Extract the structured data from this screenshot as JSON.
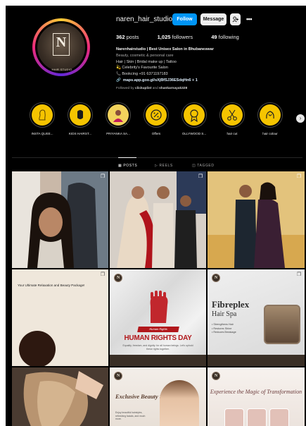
{
  "profile": {
    "username": "naren_hair_studio",
    "follow_label": "Follow",
    "message_label": "Message",
    "logo_text": "HAIR STUDIO",
    "stats": {
      "posts": "362",
      "posts_label": "posts",
      "followers": "1,025",
      "followers_label": "followers",
      "following": "49",
      "following_label": "following"
    },
    "bio": {
      "name": "Narenhairstudio | Best Unisex Salon in Bhubaneswar",
      "category": "Beauty, cosmetic & personal care",
      "line1": "Hair | Skin | Bridal make up | Tattoo",
      "line2": "💫 Celebrity's Favourite Salon",
      "line3": "📞 Bookcing +91 6371197183",
      "link": "maps.app.goo.gl/sXjBfSJ36ESdqHn6 + 1"
    },
    "followed_prefix": "Followed by",
    "followed_user1": "clickuplist",
    "followed_and": "and",
    "followed_user2": "shankarnayak328"
  },
  "highlights": [
    {
      "label": "INSTA QUEE...",
      "icon": "woman-profile-icon"
    },
    {
      "label": "KIDS HAIRST...",
      "icon": "kid-head-icon"
    },
    {
      "label": "PRIYANKA SA...",
      "icon": "portrait-photo-icon"
    },
    {
      "label": "Offers",
      "icon": "offer-badge-icon"
    },
    {
      "label": "OLLYWOOD S...",
      "icon": "award-medal-icon"
    },
    {
      "label": "hair cut",
      "icon": "scissors-icon"
    },
    {
      "label": "hair colour",
      "icon": "hair-dye-icon"
    }
  ],
  "tabs": {
    "posts": "POSTS",
    "reels": "REELS",
    "tagged": "TAGGED"
  },
  "posts": {
    "p4_caption": "Your Ultimate Relaxation and Beauty Package!",
    "p5_ribbon": "Human Rights",
    "p5_title": "HUMAN RIGHTS DAY",
    "p5_sub": "Equality, freedom, and dignity: for all human beings. Let's uphold these rights together.",
    "p6_title": "Fibreplex",
    "p6_subtitle": "Hair Spa",
    "p6_bullets": [
      "Strengthens Hair",
      "Restores Shine",
      "Reduces Breakage"
    ],
    "p8_title": "Exclusive Beauty Services",
    "p8_sub": "Enjoy beautiful hairstyles, refreshing facials, and much more.",
    "p9_title": "Experience the Magic of Transformation"
  },
  "colors": {
    "follow_blue": "#0095f6",
    "highlight_yellow": "#f5c400",
    "holiday_red": "#b1181c",
    "brand_brown": "#3a2f26"
  }
}
